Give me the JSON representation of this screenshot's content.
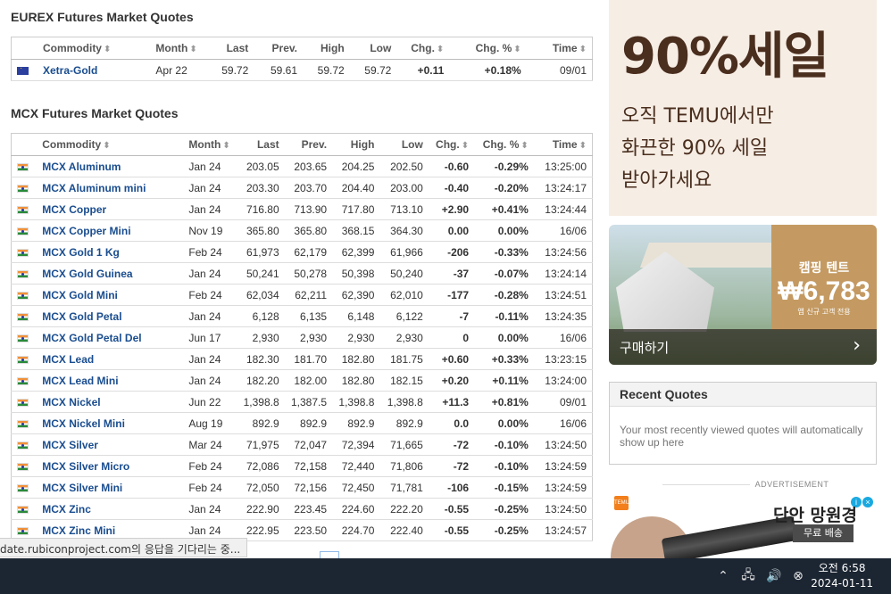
{
  "eurex": {
    "title": "EUREX Futures Market Quotes",
    "headers": {
      "commodity": "Commodity",
      "month": "Month",
      "last": "Last",
      "prev": "Prev.",
      "high": "High",
      "low": "Low",
      "chg": "Chg.",
      "chgpct": "Chg. %",
      "time": "Time"
    },
    "rows": [
      {
        "name": "Xetra-Gold",
        "month": "Apr 22",
        "last": "59.72",
        "prev": "59.61",
        "high": "59.72",
        "low": "59.72",
        "chg": "+0.11",
        "chgpct": "+0.18%",
        "time": "09/01",
        "dir": "pos"
      }
    ]
  },
  "mcx": {
    "title": "MCX Futures Market Quotes",
    "headers": {
      "commodity": "Commodity",
      "month": "Month",
      "last": "Last",
      "prev": "Prev.",
      "high": "High",
      "low": "Low",
      "chg": "Chg.",
      "chgpct": "Chg. %",
      "time": "Time"
    },
    "rows": [
      {
        "name": "MCX Aluminum",
        "month": "Jan 24",
        "last": "203.05",
        "prev": "203.65",
        "high": "204.25",
        "low": "202.50",
        "chg": "-0.60",
        "chgpct": "-0.29%",
        "time": "13:25:00",
        "dir": "neg"
      },
      {
        "name": "MCX Aluminum mini",
        "month": "Jan 24",
        "last": "203.30",
        "prev": "203.70",
        "high": "204.40",
        "low": "203.00",
        "chg": "-0.40",
        "chgpct": "-0.20%",
        "time": "13:24:17",
        "dir": "neg"
      },
      {
        "name": "MCX Copper",
        "month": "Jan 24",
        "last": "716.80",
        "prev": "713.90",
        "high": "717.80",
        "low": "713.10",
        "chg": "+2.90",
        "chgpct": "+0.41%",
        "time": "13:24:44",
        "dir": "pos"
      },
      {
        "name": "MCX Copper Mini",
        "month": "Nov 19",
        "last": "365.80",
        "prev": "365.80",
        "high": "368.15",
        "low": "364.30",
        "chg": "0.00",
        "chgpct": "0.00%",
        "time": "16/06",
        "dir": "neu"
      },
      {
        "name": "MCX Gold 1 Kg",
        "month": "Feb 24",
        "last": "61,973",
        "prev": "62,179",
        "high": "62,399",
        "low": "61,966",
        "chg": "-206",
        "chgpct": "-0.33%",
        "time": "13:24:56",
        "dir": "neg"
      },
      {
        "name": "MCX Gold Guinea",
        "month": "Jan 24",
        "last": "50,241",
        "prev": "50,278",
        "high": "50,398",
        "low": "50,240",
        "chg": "-37",
        "chgpct": "-0.07%",
        "time": "13:24:14",
        "dir": "neg"
      },
      {
        "name": "MCX Gold Mini",
        "month": "Feb 24",
        "last": "62,034",
        "prev": "62,211",
        "high": "62,390",
        "low": "62,010",
        "chg": "-177",
        "chgpct": "-0.28%",
        "time": "13:24:51",
        "dir": "neg"
      },
      {
        "name": "MCX Gold Petal",
        "month": "Jan 24",
        "last": "6,128",
        "prev": "6,135",
        "high": "6,148",
        "low": "6,122",
        "chg": "-7",
        "chgpct": "-0.11%",
        "time": "13:24:35",
        "dir": "neg"
      },
      {
        "name": "MCX Gold Petal Del",
        "month": "Jun 17",
        "last": "2,930",
        "prev": "2,930",
        "high": "2,930",
        "low": "2,930",
        "chg": "0",
        "chgpct": "0.00%",
        "time": "16/06",
        "dir": "neu"
      },
      {
        "name": "MCX Lead",
        "month": "Jan 24",
        "last": "182.30",
        "prev": "181.70",
        "high": "182.80",
        "low": "181.75",
        "chg": "+0.60",
        "chgpct": "+0.33%",
        "time": "13:23:15",
        "dir": "pos"
      },
      {
        "name": "MCX Lead Mini",
        "month": "Jan 24",
        "last": "182.20",
        "prev": "182.00",
        "high": "182.80",
        "low": "182.15",
        "chg": "+0.20",
        "chgpct": "+0.11%",
        "time": "13:24:00",
        "dir": "pos"
      },
      {
        "name": "MCX Nickel",
        "month": "Jun 22",
        "last": "1,398.8",
        "prev": "1,387.5",
        "high": "1,398.8",
        "low": "1,398.8",
        "chg": "+11.3",
        "chgpct": "+0.81%",
        "time": "09/01",
        "dir": "pos"
      },
      {
        "name": "MCX Nickel Mini",
        "month": "Aug 19",
        "last": "892.9",
        "prev": "892.9",
        "high": "892.9",
        "low": "892.9",
        "chg": "0.0",
        "chgpct": "0.00%",
        "time": "16/06",
        "dir": "neu"
      },
      {
        "name": "MCX Silver",
        "month": "Mar 24",
        "last": "71,975",
        "prev": "72,047",
        "high": "72,394",
        "low": "71,665",
        "chg": "-72",
        "chgpct": "-0.10%",
        "time": "13:24:50",
        "dir": "neg"
      },
      {
        "name": "MCX Silver Micro",
        "month": "Feb 24",
        "last": "72,086",
        "prev": "72,158",
        "high": "72,440",
        "low": "71,806",
        "chg": "-72",
        "chgpct": "-0.10%",
        "time": "13:24:59",
        "dir": "neg"
      },
      {
        "name": "MCX Silver Mini",
        "month": "Feb 24",
        "last": "72,050",
        "prev": "72,156",
        "high": "72,450",
        "low": "71,781",
        "chg": "-106",
        "chgpct": "-0.15%",
        "time": "13:24:59",
        "dir": "neg"
      },
      {
        "name": "MCX Zinc",
        "month": "Jan 24",
        "last": "222.90",
        "prev": "223.45",
        "high": "224.60",
        "low": "222.20",
        "chg": "-0.55",
        "chgpct": "-0.25%",
        "time": "13:24:50",
        "dir": "neg"
      },
      {
        "name": "MCX Zinc Mini",
        "month": "Jan 24",
        "last": "222.95",
        "prev": "223.50",
        "high": "224.70",
        "low": "222.40",
        "chg": "-0.55",
        "chgpct": "-0.25%",
        "time": "13:24:57",
        "dir": "neg"
      }
    ]
  },
  "ad_top": {
    "big": "90%세일",
    "line1": "오직 TEMU에서만",
    "line2": "화끈한 90% 세일",
    "line3": "받아가세요"
  },
  "ad_tent": {
    "label": "캠핑 텐트",
    "price": "₩6,783",
    "note": "앱 신규 고객 전용",
    "cta": "구매하기"
  },
  "recent": {
    "title": "Recent Quotes",
    "body": "Your most recently viewed quotes will automatically show up here"
  },
  "ad_label": "ADVERTISEMENT",
  "ad_bottom": {
    "logo": "TEMU",
    "headline": "단안 망원경",
    "badge": "무료 배송"
  },
  "status_text": "date.rubiconproject.com의 응답을 기다리는 중...",
  "clock": {
    "time": "오전 6:58",
    "date": "2024-01-11"
  },
  "colors": {
    "positive": "#1a9e1a",
    "negative": "#dd1111",
    "link": "#1a4d8f",
    "taskbar": "#1c2532"
  }
}
